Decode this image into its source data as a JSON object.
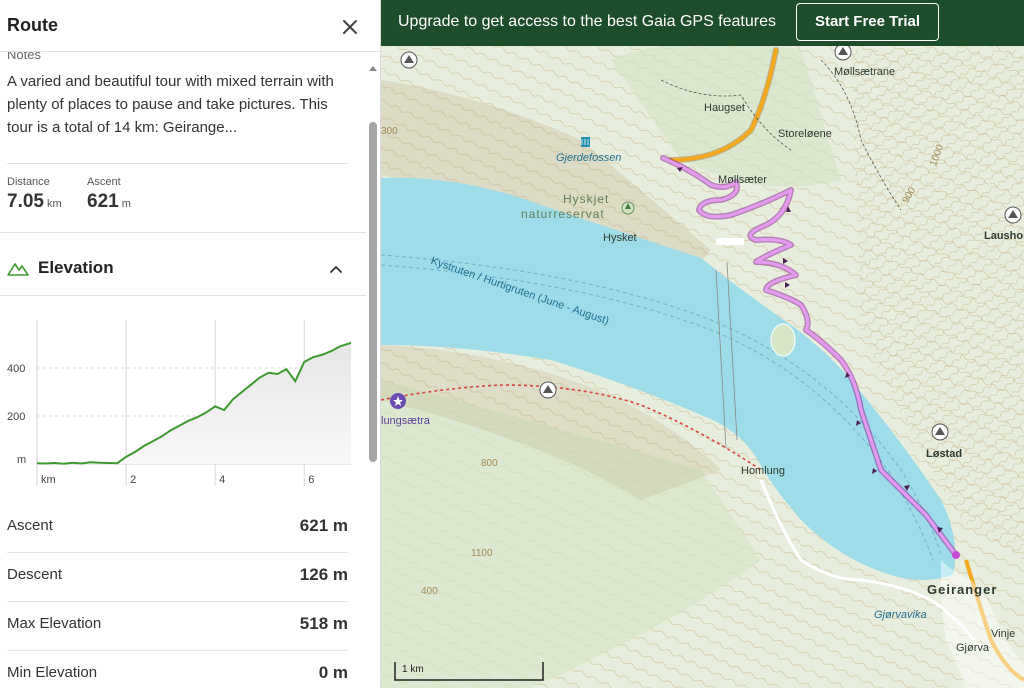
{
  "panel": {
    "title": "Route",
    "notes_label": "Notes",
    "notes_text": "A varied and beautiful tour with mixed terrain with plenty of places to pause and take pictures. This tour is a total of 14 km: Geirange...",
    "stats": [
      {
        "label": "Distance",
        "value": "7.05",
        "unit": "km"
      },
      {
        "label": "Ascent",
        "value": "621",
        "unit": "m"
      }
    ],
    "elevation_title": "Elevation",
    "rows": [
      {
        "label": "Ascent",
        "value": "621 m"
      },
      {
        "label": "Descent",
        "value": "126 m"
      },
      {
        "label": "Max Elevation",
        "value": "518 m"
      },
      {
        "label": "Min Elevation",
        "value": "0 m"
      }
    ]
  },
  "chart_data": {
    "type": "area",
    "x_unit": "km",
    "y_unit": "m",
    "x_ticks": [
      2,
      4,
      6
    ],
    "y_ticks": [
      200,
      400
    ],
    "xlim": [
      0,
      7.05
    ],
    "ylim": [
      0,
      600
    ],
    "x": [
      0,
      0.2,
      0.4,
      0.6,
      0.8,
      1.0,
      1.2,
      1.4,
      1.6,
      1.8,
      2.0,
      2.2,
      2.4,
      2.6,
      2.8,
      3.0,
      3.2,
      3.4,
      3.6,
      3.8,
      4.0,
      4.2,
      4.4,
      4.6,
      4.8,
      5.0,
      5.2,
      5.4,
      5.6,
      5.8,
      6.0,
      6.2,
      6.4,
      6.6,
      6.8,
      7.05
    ],
    "y": [
      3,
      2,
      4,
      1,
      5,
      2,
      7,
      5,
      4,
      3,
      30,
      50,
      75,
      95,
      115,
      140,
      160,
      180,
      195,
      215,
      240,
      225,
      270,
      300,
      330,
      360,
      380,
      375,
      395,
      345,
      425,
      445,
      455,
      470,
      490,
      505
    ],
    "series_color": "#3c9a2e"
  },
  "banner": {
    "text": "Upgrade to get access to the best Gaia GPS features",
    "button": "Start Free Trial"
  },
  "map": {
    "labels": [
      {
        "text": "Møllsætrane"
      },
      {
        "text": "Haugset"
      },
      {
        "text": "Storeløene"
      },
      {
        "text": "Gjerdefossen"
      },
      {
        "text": "Møllsæter"
      },
      {
        "text": "Hyskjet"
      },
      {
        "text": "naturreservat"
      },
      {
        "text": "Hysket"
      },
      {
        "text": "Laushor"
      },
      {
        "text": "Kystruten / Hurtigruten (June - August)"
      },
      {
        "text": "lungsætra"
      },
      {
        "text": "Løstad"
      },
      {
        "text": "Homlung"
      },
      {
        "text": "Geiranger"
      },
      {
        "text": "Gjørvavika"
      },
      {
        "text": "Vinje"
      },
      {
        "text": "Gjørva"
      },
      {
        "text": "800"
      },
      {
        "text": "300"
      },
      {
        "text": "1000"
      },
      {
        "text": "1100"
      },
      {
        "text": "900"
      },
      {
        "text": "400"
      }
    ],
    "scale_label": "1 km",
    "colors": {
      "water": "#9fdcea",
      "land": "#e9efe0",
      "route": "#d67fe0",
      "road": "#f4a81d",
      "trail": "#d9423b"
    }
  }
}
